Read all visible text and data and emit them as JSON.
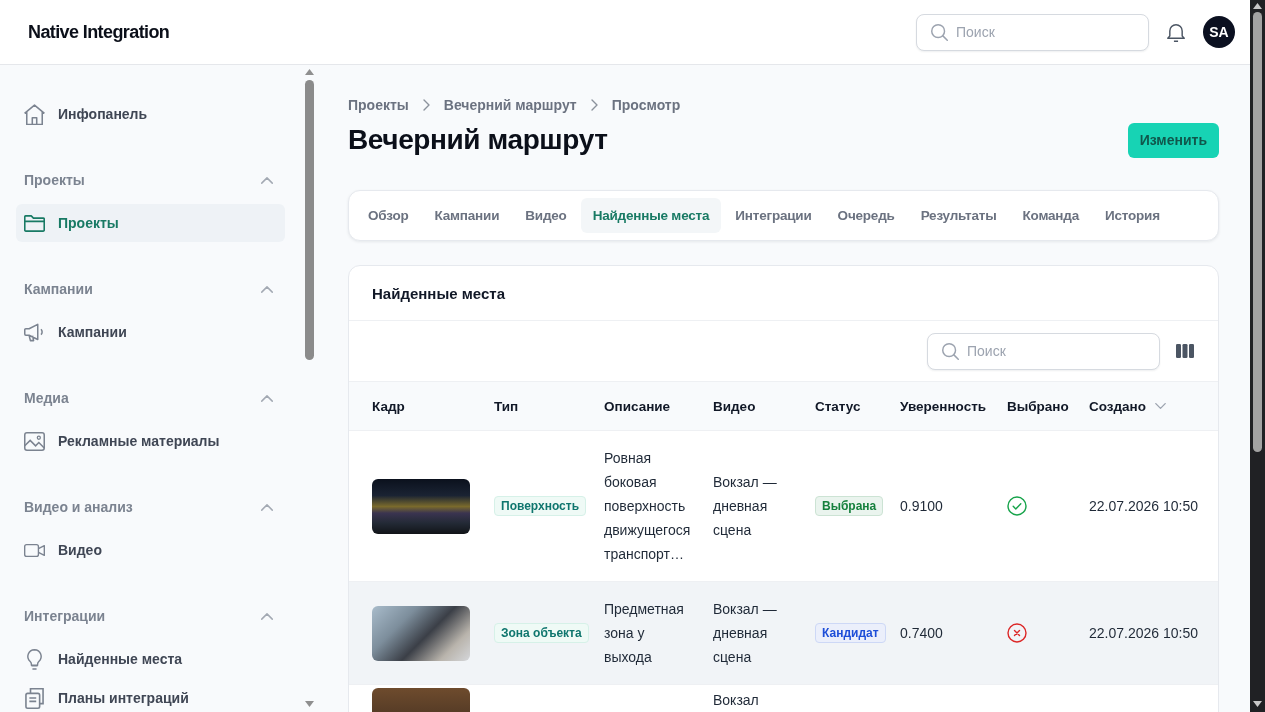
{
  "header": {
    "logo": "Native Integration",
    "search": {
      "placeholder": "Поиск"
    },
    "avatar": "SA"
  },
  "sidebar": {
    "items": [
      {
        "kind": "link",
        "label": "Инфопанель",
        "selected": false
      },
      {
        "kind": "group",
        "title": "Проекты",
        "expanded": true,
        "children": [
          {
            "label": "Проекты",
            "selected": true
          }
        ]
      },
      {
        "kind": "group",
        "title": "Кампании",
        "expanded": true,
        "children": [
          {
            "label": "Кампании",
            "selected": false
          }
        ]
      },
      {
        "kind": "group",
        "title": "Медиа",
        "expanded": true,
        "children": [
          {
            "label": "Рекламные материалы",
            "selected": false
          }
        ]
      },
      {
        "kind": "group",
        "title": "Видео и анализ",
        "expanded": true,
        "children": [
          {
            "label": "Видео",
            "selected": false
          }
        ]
      },
      {
        "kind": "group",
        "title": "Интеграции",
        "expanded": true,
        "children": [
          {
            "label": "Найденные места",
            "selected": false
          },
          {
            "label": "Планы интеграций",
            "selected": false
          }
        ]
      }
    ]
  },
  "breadcrumb": [
    "Проекты",
    "Вечерний маршрут",
    "Просмотр"
  ],
  "page_title": "Вечерний маршрут",
  "edit_button": "Изменить",
  "tabs": [
    {
      "label": "Обзор",
      "selected": false
    },
    {
      "label": "Кампании",
      "selected": false
    },
    {
      "label": "Видео",
      "selected": false
    },
    {
      "label": "Найденные места",
      "selected": true
    },
    {
      "label": "Интеграции",
      "selected": false
    },
    {
      "label": "Очередь",
      "selected": false
    },
    {
      "label": "Результаты",
      "selected": false
    },
    {
      "label": "Команда",
      "selected": false
    },
    {
      "label": "История",
      "selected": false
    }
  ],
  "panel": {
    "title": "Найденные места",
    "search": {
      "placeholder": "Поиск"
    },
    "table": {
      "columns": [
        {
          "label": "Кадр",
          "sorted": false
        },
        {
          "label": "Тип",
          "sorted": false
        },
        {
          "label": "Описание",
          "sorted": false
        },
        {
          "label": "Видео",
          "sorted": false
        },
        {
          "label": "Статус",
          "sorted": false
        },
        {
          "label": "Уверенность",
          "sorted": false
        },
        {
          "label": "Выбрано",
          "sorted": false
        },
        {
          "label": "Создано",
          "sorted": true
        }
      ],
      "rows": [
        {
          "highlighted": false,
          "type": "Поверхность",
          "description": "Ровная боковая поверхность движущегося транспорт…",
          "video": "Вокзал — дневная сцена",
          "status": {
            "label": "Выбрана",
            "color": "#15803d"
          },
          "confidence": "0.9100",
          "chosen": true,
          "created": "22.07.2026 10:50"
        },
        {
          "highlighted": true,
          "type": "Зона объекта",
          "description": "Предметная зона у выхода",
          "video": "Вокзал — дневная сцена",
          "status": {
            "label": "Кандидат",
            "color": "#1d4ed8"
          },
          "confidence": "0.7400",
          "chosen": false,
          "created": "22.07.2026 10:50"
        },
        {
          "highlighted": false,
          "video": "Вокзал"
        }
      ]
    }
  }
}
